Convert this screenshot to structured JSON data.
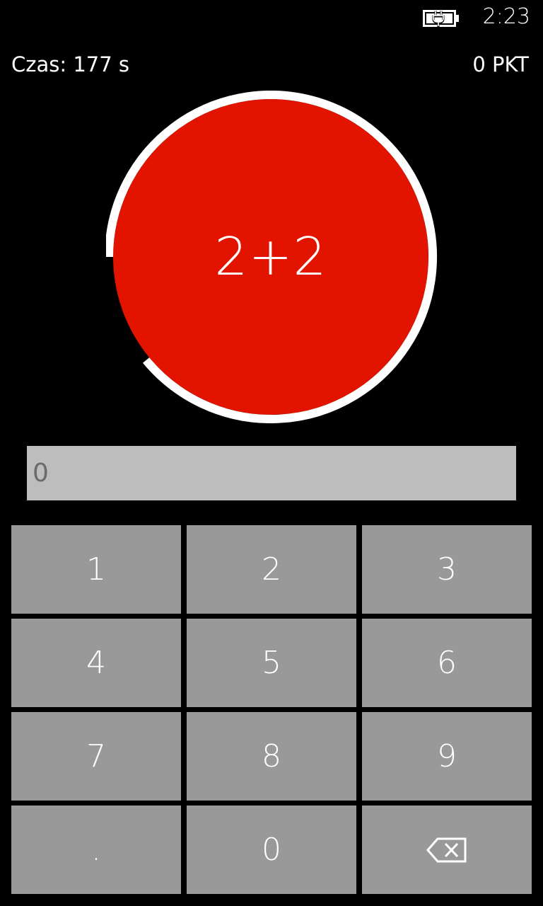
{
  "status_bar": {
    "time": "2:23",
    "battery_icon": "battery-charging-icon"
  },
  "header": {
    "timer": "Czas: 177 s",
    "score": "0 PKT"
  },
  "question": {
    "text": "2+2",
    "circle_color": "#e21400",
    "ring_color": "#ffffff",
    "time_progress": 0.89
  },
  "answer": {
    "value": "",
    "placeholder": "0"
  },
  "keypad": {
    "keys": [
      "1",
      "2",
      "3",
      "4",
      "5",
      "6",
      "7",
      "8",
      "9",
      ".",
      "0"
    ],
    "backspace_icon": "backspace-icon",
    "key_color": "#999999"
  }
}
